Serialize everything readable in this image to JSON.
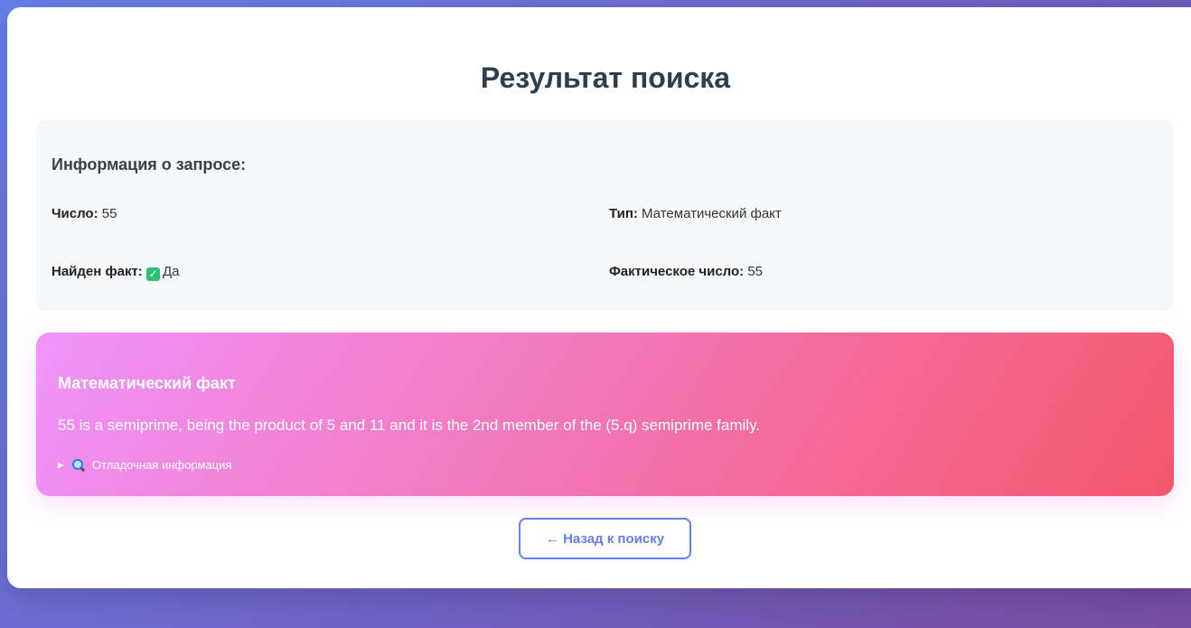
{
  "page": {
    "title": "Результат поиска"
  },
  "query_info": {
    "heading": "Информация о запросе:",
    "number_label": "Число:",
    "number_value": "55",
    "type_label": "Тип:",
    "type_value": "Математический факт",
    "found_label": "Найден факт:",
    "found_value": "Да",
    "found_icon": "check-mark-icon",
    "actual_label": "Фактическое число:",
    "actual_value": "55"
  },
  "fact": {
    "title": "Математический факт",
    "text": "55 is a semiprime, being the product of 5 and 11 and it is the 2nd member of the (5.q) semiprime family.",
    "debug_label": "Отладочная информация",
    "debug_icon": "magnifier-icon"
  },
  "actions": {
    "back_label": "← Назад к поиску"
  },
  "colors": {
    "background_start": "#667eea",
    "background_end": "#764ba2",
    "fact_gradient_start": "#f093fb",
    "fact_gradient_end": "#f5576c",
    "accent": "#667eea",
    "title": "#2c3e50",
    "success": "#2fbf71"
  }
}
